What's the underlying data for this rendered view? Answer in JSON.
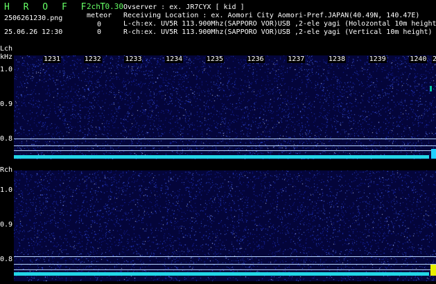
{
  "header": {
    "title": "H R O F F T",
    "channels": "2ch 0.30",
    "event_label": "meteor",
    "filename": "2506261230.png",
    "datetime": "25.06.26 12:30",
    "count_l": "0",
    "count_r": "0",
    "observer": "Ovserver            : ex. JR7CYX [ kid ]",
    "location": "Receiving Location : ex. Aomori City Aomori-Pref.JAPAN(40.49N, 140.47E)",
    "lch_info": "L-ch:ex. UV5R 113.900Mhz(SAPPORO VOR)USB ,2-ele yagi (Holozontal 10m height)",
    "rch_info": "R-ch:ex. UV5R 113.900Mhz(SAPPORO VOR)USB ,2-ele yagi (Vertical 10m height)"
  },
  "lch": {
    "label": "Lch",
    "unit": "kHz",
    "y_labels": [
      "1.0",
      "0.9",
      "0.8"
    ]
  },
  "rch": {
    "label": "Rch",
    "y_labels": [
      "1.0",
      "0.9",
      "0.8"
    ]
  },
  "minutes": [
    "1231",
    "1232",
    "1233",
    "1234",
    "1235",
    "1236",
    "1237",
    "1238",
    "1239",
    "1240",
    "2"
  ],
  "colors": {
    "background": "#04053a",
    "noise_floor": "#22d6e6",
    "marker_line": "#b9d6ff",
    "signal": "#e8f000"
  }
}
